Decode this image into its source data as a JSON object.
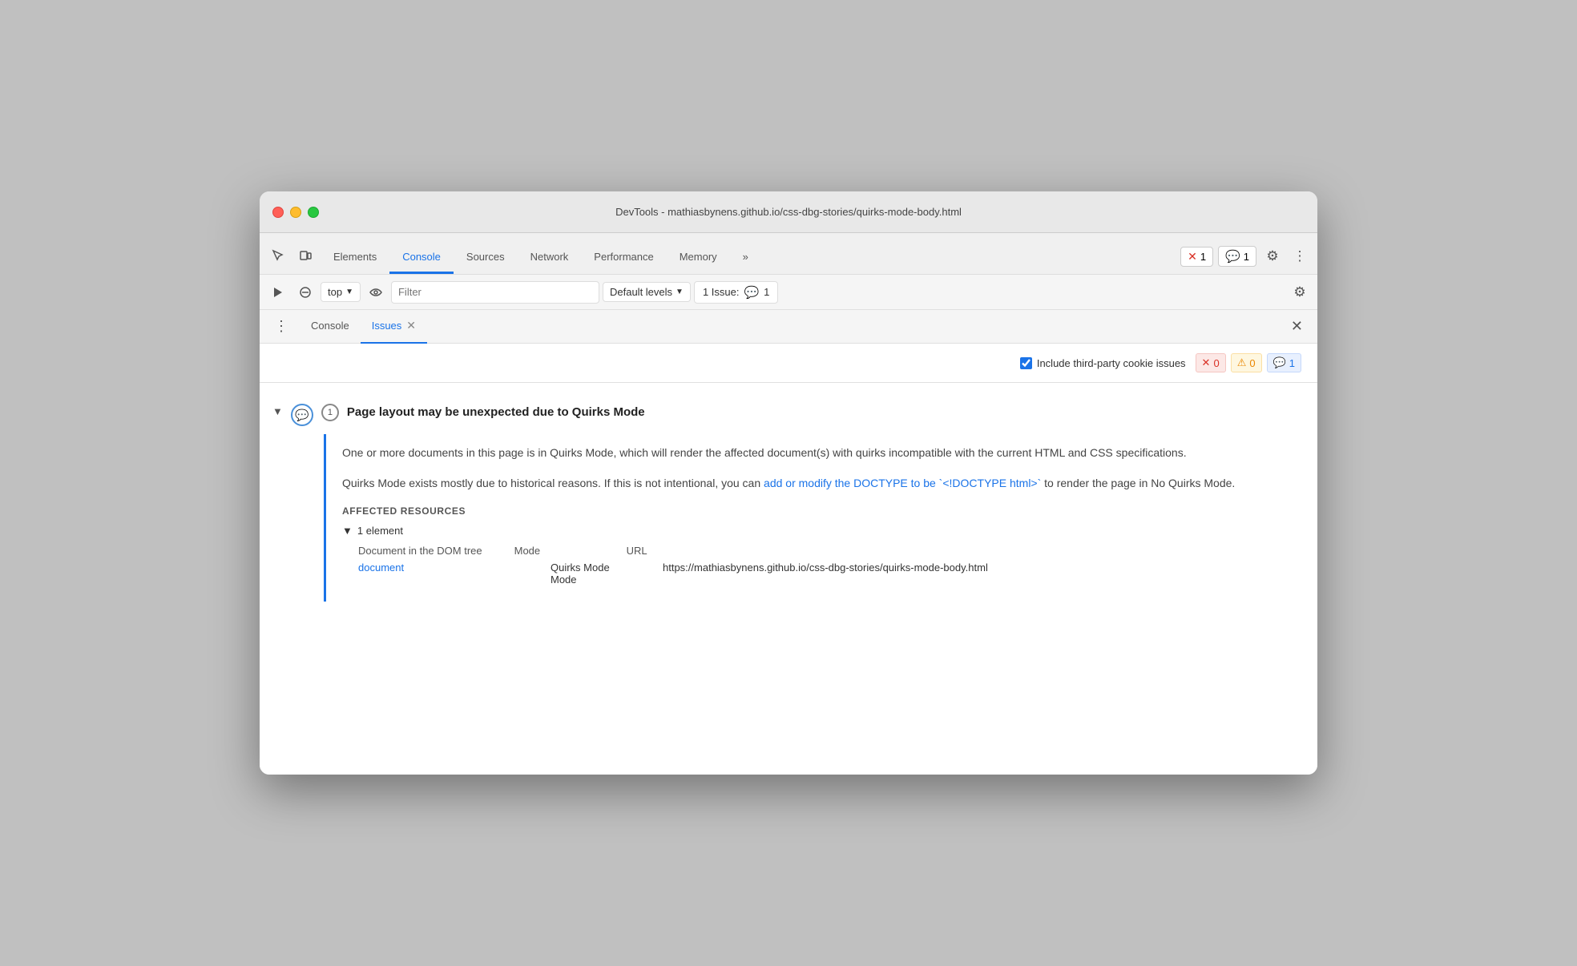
{
  "window": {
    "title": "DevTools - mathiasbynens.github.io/css-dbg-stories/quirks-mode-body.html"
  },
  "tabs": {
    "items": [
      {
        "id": "elements",
        "label": "Elements"
      },
      {
        "id": "console",
        "label": "Console",
        "active": true
      },
      {
        "id": "sources",
        "label": "Sources"
      },
      {
        "id": "network",
        "label": "Network"
      },
      {
        "id": "performance",
        "label": "Performance"
      },
      {
        "id": "memory",
        "label": "Memory"
      }
    ],
    "more_label": "»",
    "error_count": "1",
    "message_count": "1"
  },
  "toolbar": {
    "context_label": "top",
    "filter_placeholder": "Filter",
    "default_levels_label": "Default levels",
    "issue_label": "1 Issue:",
    "issue_count": "1"
  },
  "secondary_tabs": {
    "items": [
      {
        "id": "console",
        "label": "Console"
      },
      {
        "id": "issues",
        "label": "Issues",
        "active": true,
        "closeable": true
      }
    ]
  },
  "issues_panel": {
    "checkbox_label": "Include third-party cookie issues",
    "checkbox_checked": true,
    "error_count": "0",
    "warning_count": "0",
    "info_count": "1",
    "issue": {
      "title": "Page layout may be unexpected due to Quirks Mode",
      "count": "1",
      "description_1": "One or more documents in this page is in Quirks Mode, which will render the affected document(s) with quirks incompatible with the current HTML and CSS specifications.",
      "description_2_before": "Quirks Mode exists mostly due to historical reasons. If this is not intentional, you can ",
      "description_2_link": "add or modify the DOCTYPE to be `<!DOCTYPE html>`",
      "description_2_after": " to render the page in No Quirks Mode.",
      "affected_label": "AFFECTED RESOURCES",
      "element_count": "1 element",
      "col_doc": "Document in the DOM tree",
      "col_mode": "Mode",
      "col_url": "URL",
      "row_doc_link": "document",
      "row_mode": "Quirks Mode",
      "row_url": "https://mathiasbynens.github.io/css-dbg-stories/quirks-mode-body.html"
    }
  }
}
